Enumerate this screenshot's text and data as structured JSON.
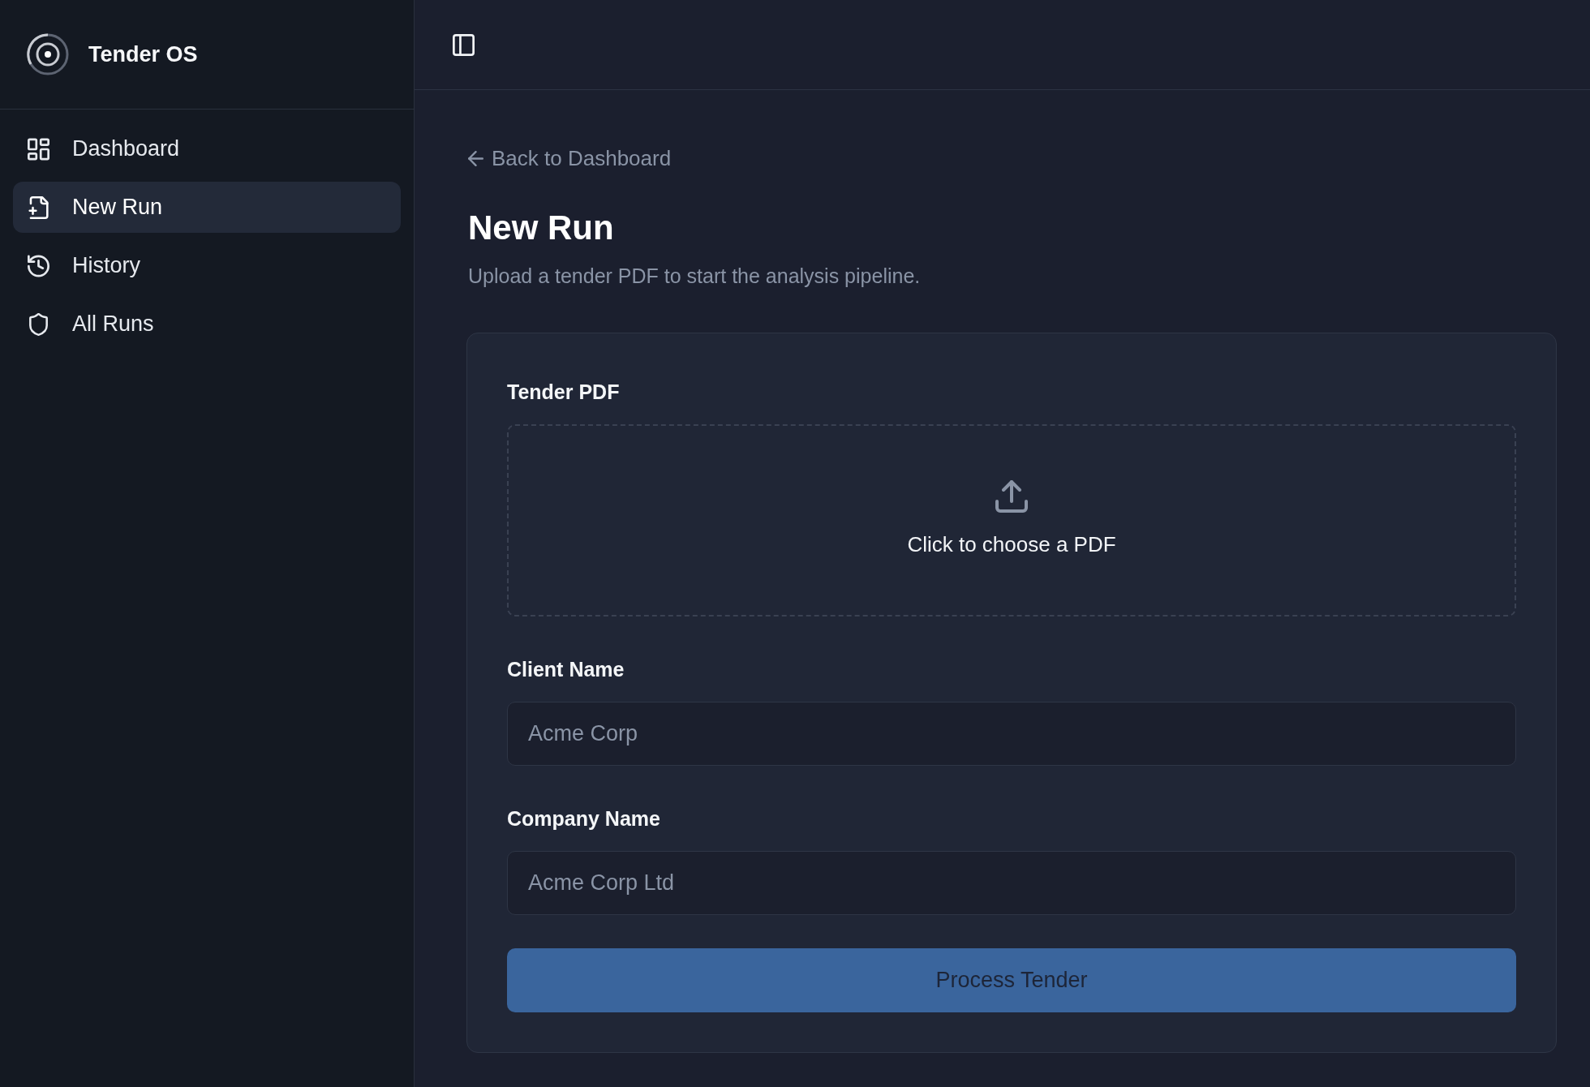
{
  "app": {
    "name": "Tender OS"
  },
  "sidebar": {
    "items": [
      {
        "label": "Dashboard",
        "selected": false
      },
      {
        "label": "New Run",
        "selected": true
      },
      {
        "label": "History",
        "selected": false
      },
      {
        "label": "All Runs",
        "selected": false
      }
    ]
  },
  "page": {
    "back_link": "Back to Dashboard",
    "title": "New Run",
    "subtitle": "Upload a tender PDF to start the analysis pipeline."
  },
  "form": {
    "upload": {
      "label": "Tender PDF",
      "prompt": "Click to choose a PDF"
    },
    "fields": [
      {
        "label": "Client Name",
        "placeholder": "Acme Corp"
      },
      {
        "label": "Company Name",
        "placeholder": "Acme Corp Ltd"
      }
    ],
    "submit": {
      "label": "Process Tender",
      "disabled": true
    }
  }
}
